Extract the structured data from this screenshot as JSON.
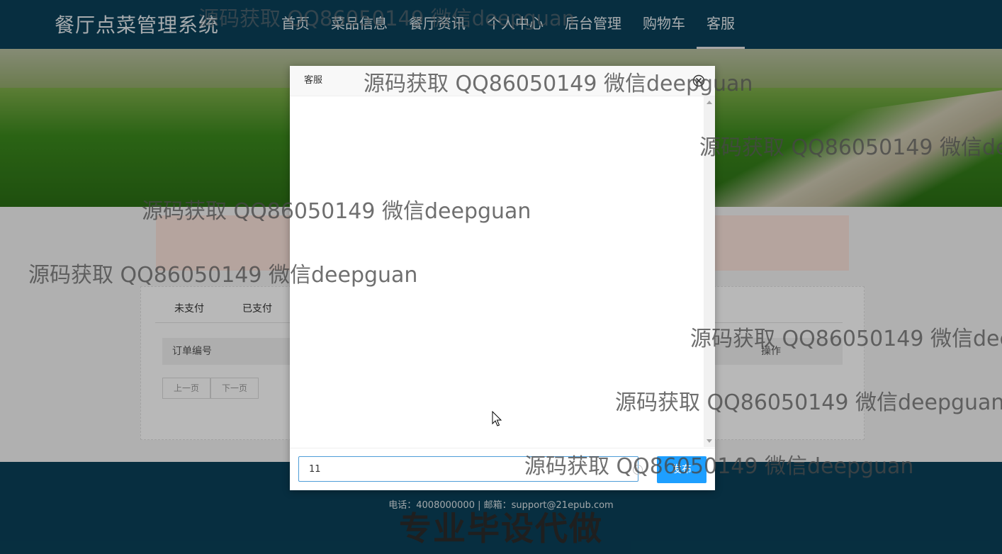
{
  "header": {
    "brand": "餐厅点菜管理系统",
    "nav": [
      "首页",
      "菜品信息",
      "餐厅资讯",
      "个人中心",
      "后台管理",
      "购物车",
      "客服"
    ],
    "active_nav": "客服"
  },
  "orders": {
    "tabs": [
      "未支付",
      "已支付"
    ],
    "columns": {
      "order_no": "订单编号",
      "action": "操作"
    },
    "pager": {
      "prev": "上一页",
      "next": "下一页"
    }
  },
  "footer": {
    "contact": "电话：4008000000 | 邮箱：support@21epub.com",
    "slogan": "专业毕设代做"
  },
  "dialog": {
    "title": "客服",
    "input_value": "11",
    "send_label": "发布"
  },
  "watermark": {
    "text": "源码获取 QQ86050149 微信deepguan"
  },
  "colors": {
    "header_bg": "#0a4159",
    "send_button": "#1e9fff",
    "promo_bg": "#fbe3dc"
  },
  "icons": [
    "close-icon",
    "clear-icon",
    "scroll-up-icon",
    "scroll-down-icon",
    "mouse-cursor-icon"
  ]
}
